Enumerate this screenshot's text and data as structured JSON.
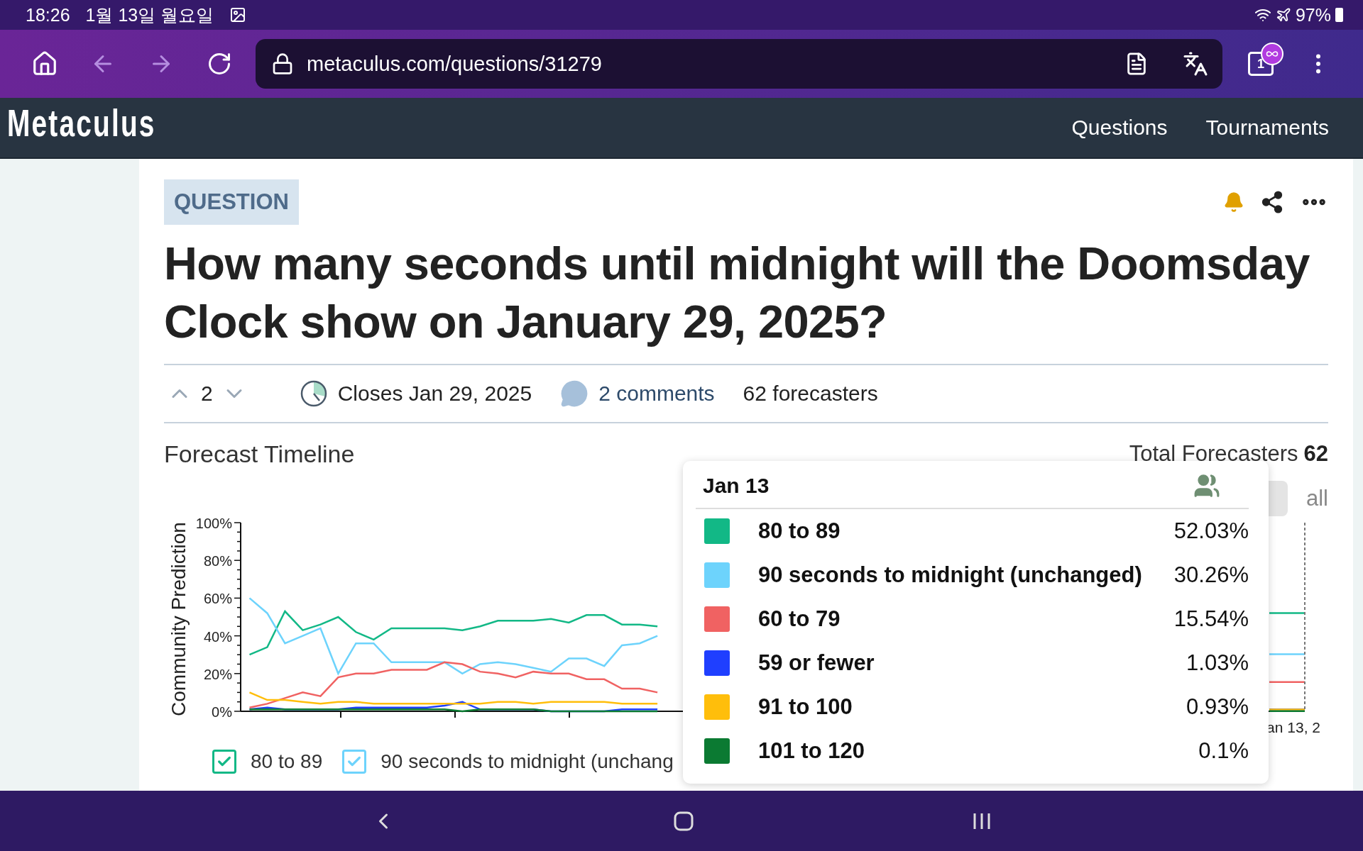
{
  "status_bar": {
    "time": "18:26",
    "date": "1월 13일 월요일",
    "battery": "97%"
  },
  "browser": {
    "url": "metaculus.com/questions/31279",
    "tab_count": "1"
  },
  "site_header": {
    "logo": "Metaculus",
    "nav": [
      "Questions",
      "Tournaments"
    ]
  },
  "question": {
    "badge": "QUESTION",
    "title": "How many seconds until midnight will the Doomsday Clock show on January 29, 2025?",
    "votes": "2",
    "closes": "Closes Jan 29, 2025",
    "comments": "2 comments",
    "forecasters": "62 forecasters"
  },
  "timeline": {
    "heading": "Forecast Timeline",
    "total_label": "Total Forecasters",
    "total_value": "62",
    "range_button": "all",
    "end_date_label": "an 13, 2",
    "chart_data": {
      "type": "line",
      "ylabel": "Community Prediction",
      "ylim": [
        0,
        100
      ],
      "yticks": [
        {
          "value": 0,
          "label": "0%"
        },
        {
          "value": 20,
          "label": "20%"
        },
        {
          "value": 40,
          "label": "40%"
        },
        {
          "value": 60,
          "label": "60%"
        },
        {
          "value": 80,
          "label": "80%"
        },
        {
          "value": 100,
          "label": "100%"
        }
      ],
      "series": [
        {
          "name": "80 to 89",
          "color": "#12b886",
          "values": [
            30,
            34,
            53,
            43,
            46,
            50,
            42,
            38,
            44,
            44,
            44,
            44,
            43,
            45,
            48,
            48,
            48,
            49,
            47,
            51,
            51,
            46,
            46,
            45,
            null,
            null,
            null,
            null,
            null,
            null,
            null,
            null,
            null,
            null,
            null,
            null,
            null,
            null,
            null,
            null,
            null,
            null,
            null,
            null,
            null,
            null,
            null,
            null,
            null,
            null,
            null,
            null,
            null,
            null,
            null,
            null,
            null,
            null,
            null,
            null
          ]
        },
        {
          "name": "90 seconds to midnight (unchanged)",
          "color": "#6dd3fc",
          "values": [
            60,
            52,
            36,
            40,
            44,
            20,
            36,
            36,
            26,
            26,
            26,
            26,
            20,
            25,
            26,
            25,
            23,
            21,
            28,
            28,
            24,
            35,
            36,
            40,
            null,
            null,
            null,
            null,
            null,
            null,
            null,
            null,
            null,
            null,
            null,
            null,
            null,
            null,
            null,
            null,
            null,
            null,
            null,
            null,
            null,
            null,
            null,
            null,
            null,
            null,
            null,
            null,
            null,
            null,
            null,
            null,
            null,
            null,
            null,
            null
          ]
        },
        {
          "name": "60 to 79",
          "color": "#f06262",
          "values": [
            2,
            4,
            7,
            10,
            8,
            18,
            20,
            20,
            22,
            22,
            22,
            26,
            25,
            21,
            20,
            18,
            21,
            20,
            20,
            17,
            17,
            12,
            12,
            10,
            null,
            null,
            null,
            null,
            null,
            null,
            null,
            null,
            null,
            null,
            null,
            null,
            null,
            null,
            null,
            null,
            null,
            null,
            null,
            null,
            null,
            null,
            null,
            null,
            null,
            null,
            null,
            null,
            null,
            null,
            null,
            null,
            null,
            null,
            null,
            null
          ]
        },
        {
          "name": "59 or fewer",
          "color": "#1f3fff",
          "values": [
            1,
            2,
            1,
            1,
            1,
            1,
            2,
            2,
            2,
            2,
            2,
            3,
            5,
            1,
            1,
            1,
            1,
            0,
            0,
            0,
            0,
            1,
            1,
            1,
            null,
            null,
            null,
            null,
            null,
            null,
            null,
            null,
            null,
            null,
            null,
            null,
            null,
            null,
            null,
            null,
            null,
            null,
            null,
            null,
            null,
            null,
            null,
            null,
            null,
            null,
            null,
            null,
            null,
            null,
            null,
            null,
            null,
            null,
            null,
            null
          ]
        },
        {
          "name": "91 to 100",
          "color": "#ffbe0b",
          "values": [
            10,
            6,
            6,
            5,
            4,
            5,
            5,
            4,
            4,
            4,
            4,
            4,
            4,
            4,
            5,
            5,
            4,
            5,
            5,
            5,
            5,
            4,
            4,
            4,
            null,
            null,
            null,
            null,
            null,
            null,
            null,
            null,
            null,
            null,
            null,
            null,
            null,
            null,
            null,
            null,
            null,
            null,
            null,
            null,
            null,
            null,
            null,
            null,
            null,
            null,
            null,
            null,
            null,
            null,
            null,
            null,
            null,
            null,
            null,
            null
          ]
        },
        {
          "name": "101 to 120",
          "color": "#0b7a32",
          "values": [
            1,
            1,
            1,
            1,
            1,
            1,
            1,
            1,
            1,
            1,
            1,
            1,
            0,
            1,
            1,
            1,
            1,
            0,
            0,
            0,
            0,
            0,
            0,
            0,
            null,
            null,
            null,
            null,
            null,
            null,
            null,
            null,
            null,
            null,
            null,
            null,
            null,
            null,
            null,
            null,
            null,
            null,
            null,
            null,
            null,
            null,
            null,
            null,
            null,
            null,
            null,
            null,
            null,
            null,
            null,
            null,
            null,
            null,
            null,
            null
          ]
        }
      ]
    },
    "legend": [
      {
        "label": "80 to 89",
        "color": "#12b886",
        "checked": true
      },
      {
        "label": "90 seconds to midnight (unchang",
        "color": "#6dd3fc",
        "checked": true
      }
    ],
    "tooltip": {
      "date": "Jan 13",
      "values": [
        "52.03%",
        "30.26%",
        "15.54%",
        "1.03%",
        "0.93%",
        "0.1%"
      ]
    }
  }
}
